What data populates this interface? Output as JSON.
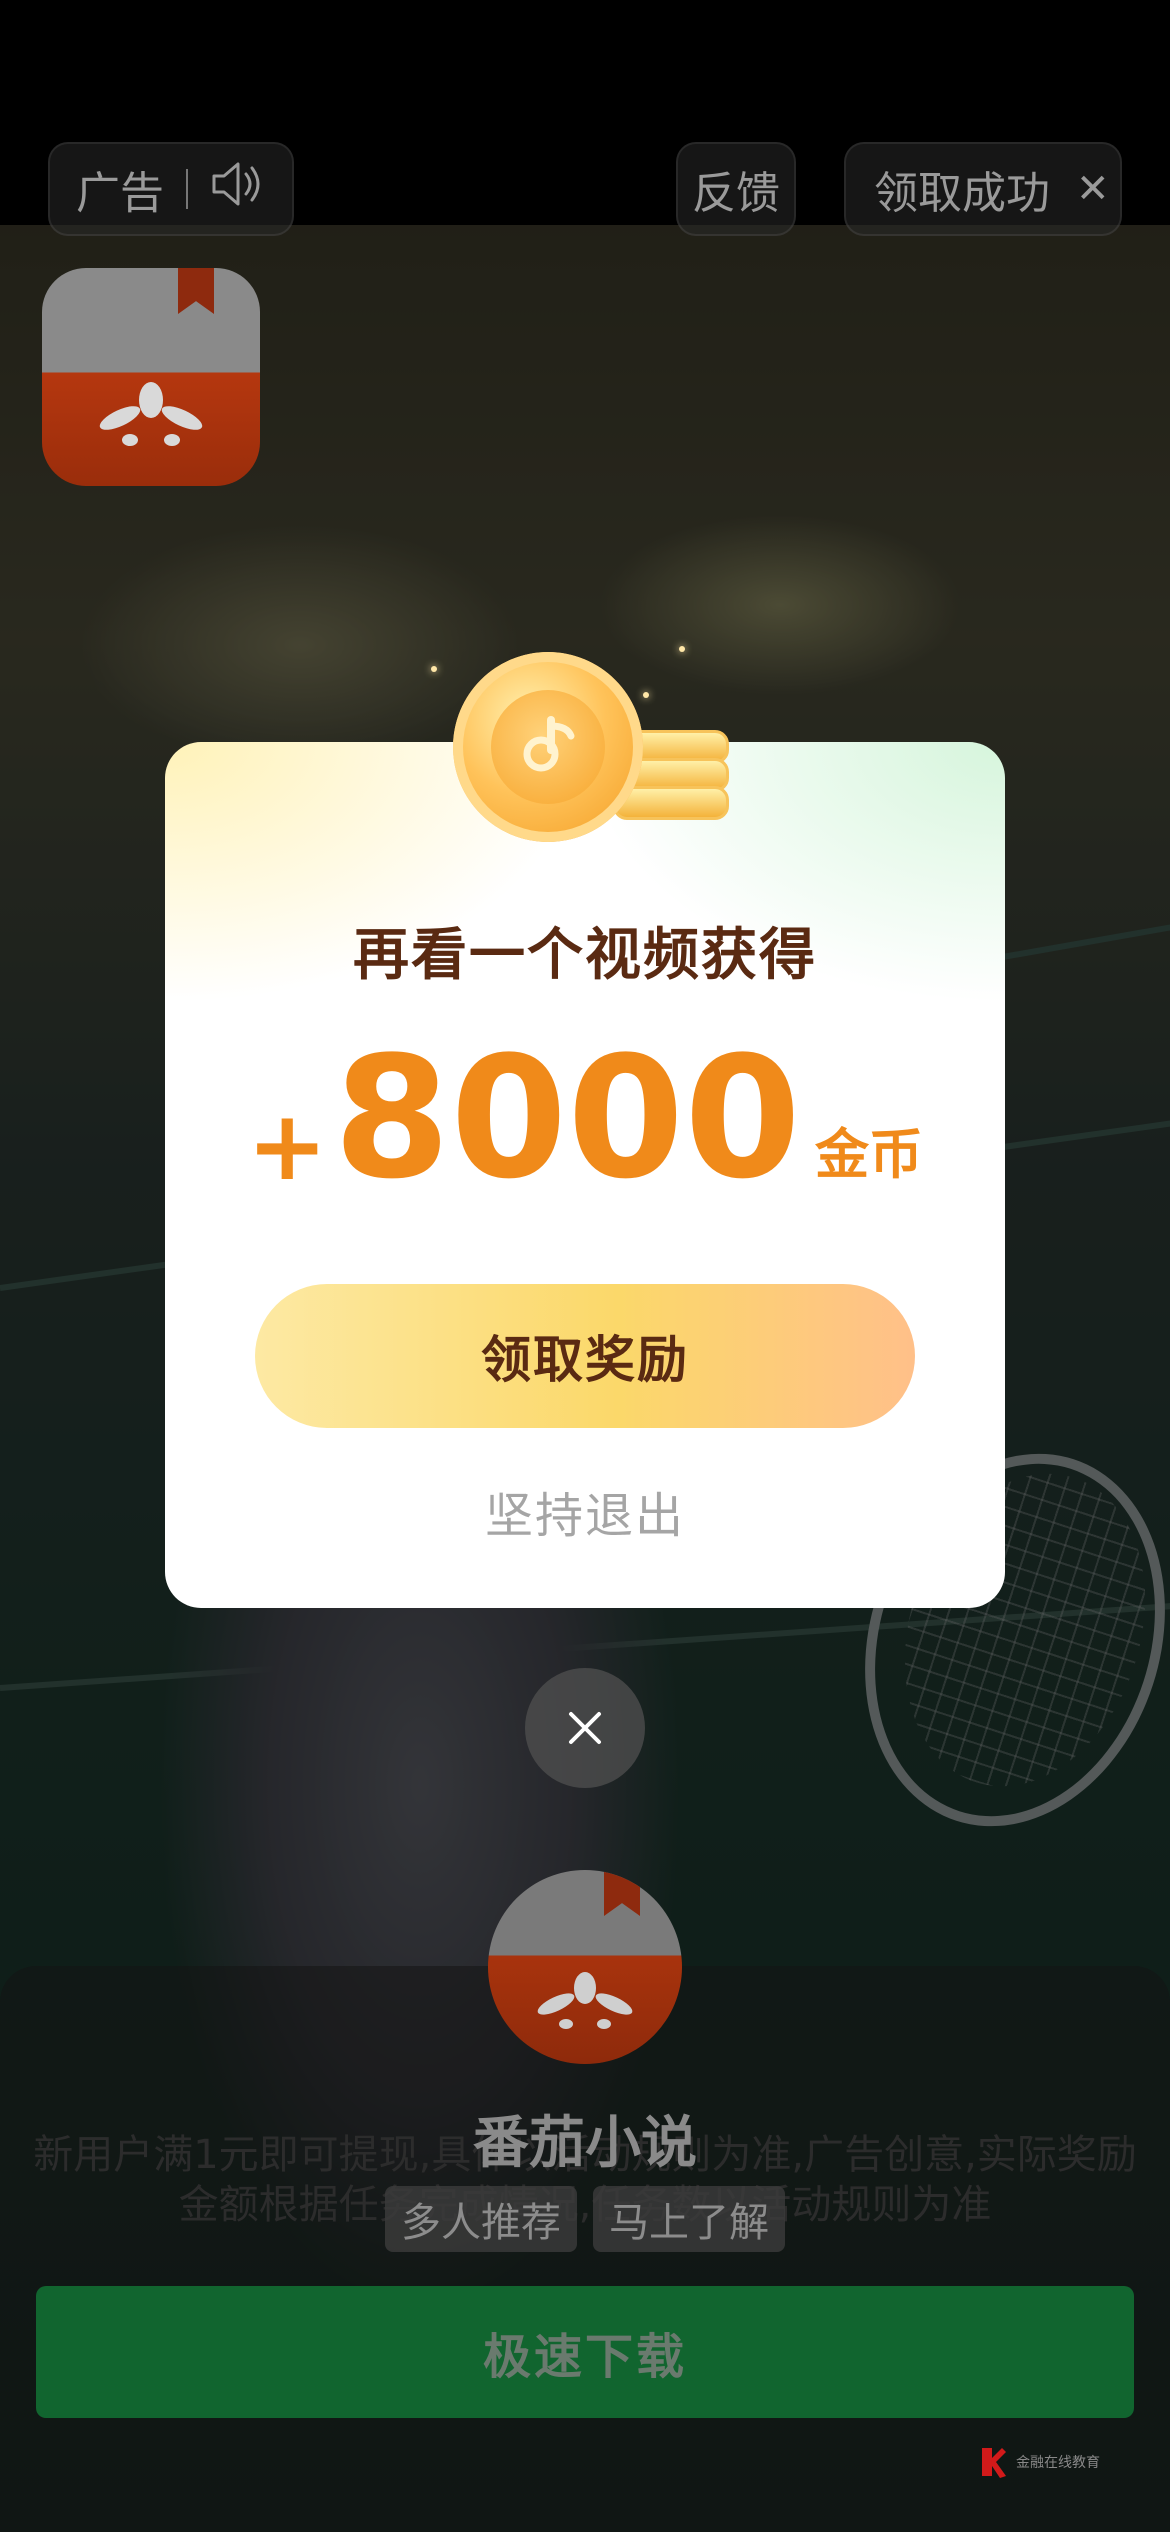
{
  "top_bar": {
    "ad_label": "广告",
    "feedback_label": "反馈",
    "reward_status": "领取成功"
  },
  "dialog": {
    "title": "再看一个视频获得",
    "amount_prefix": "+",
    "amount": "8000",
    "unit": "金币",
    "claim_button": "领取奖励",
    "quit_link": "坚持退出"
  },
  "ad_card": {
    "app_name": "番茄小说",
    "tags": [
      "多人推荐",
      "马上了解"
    ],
    "background_text": "新用户满1元即可提现,具体以活动规则为准,广告创意,实际奖励金额根据任务完成情况,任务数以活动规则为准",
    "download_button": "极速下载"
  },
  "watermark": {
    "text": "金融在线教育"
  },
  "colors": {
    "accent_orange": "#f08a1a",
    "title_brown": "#5a2a12",
    "download_green": "#11652f"
  }
}
